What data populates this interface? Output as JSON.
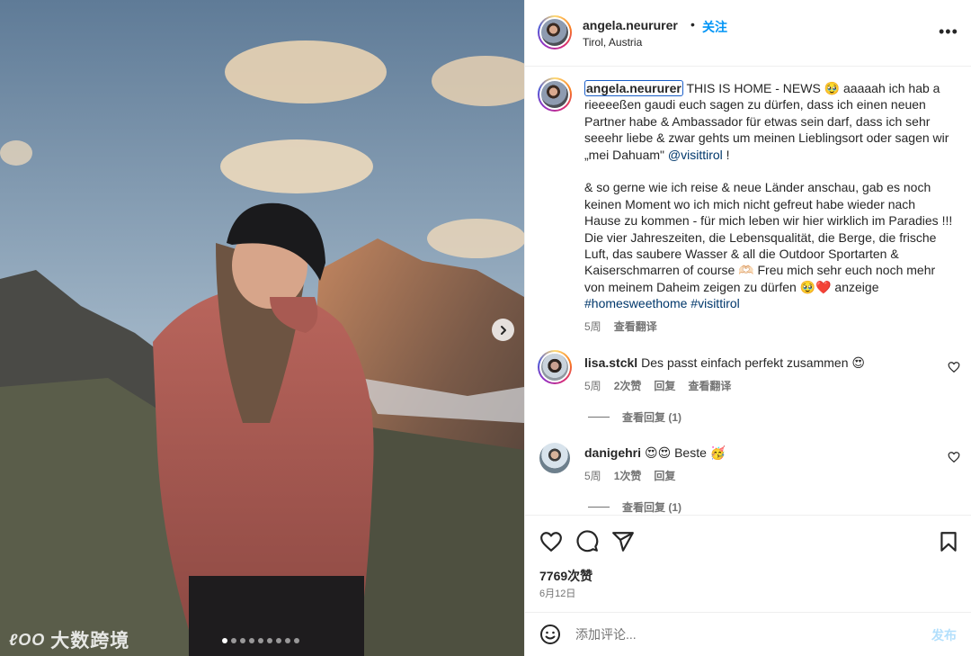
{
  "photo": {
    "carousel_total": 9,
    "carousel_active": 1,
    "watermark": "大数跨境",
    "watermark_logo": "ℓOO"
  },
  "header": {
    "username": "angela.neururer",
    "separator": "•",
    "follow_label": "关注",
    "location": "Tirol, Austria",
    "more_label": "•••"
  },
  "caption": {
    "username": "angela.neururer",
    "para1_a": " THIS IS HOME - NEWS 🥹 aaaaah ich hab a rieeeeßen gaudi euch sagen zu dürfen, dass ich einen neuen Partner habe & Ambassador für etwas sein darf, dass ich sehr seeehr liebe & zwar gehts um meinen Lieblingsort oder sagen wir „mei Dahuam\" ",
    "mention": "@visittirol",
    "para1_b": " !",
    "para2": "& so gerne wie ich reise & neue Länder anschau, gab es noch keinen Moment wo ich mich nicht gefreut habe wieder nach Hause zu kommen - für mich leben wir hier wirklich im Paradies !!! Die vier Jahreszeiten, die Lebensqualität, die Berge, die frische Luft, das saubere Wasser & all die Outdoor Sportarten & Kaiserschmarren of course 🫶🏻 Freu mich sehr euch noch mehr von meinem Daheim zeigen zu dürfen 🥹❤️ anzeige ",
    "hashtag1": "#homesweethome",
    "hashtag2": "#visittirol",
    "time": "5周",
    "translate": "查看翻译"
  },
  "comments": [
    {
      "username": "lisa.stckl",
      "text": "Des passt einfach perfekt zusammen 😍",
      "time": "5周",
      "likes": "2次赞",
      "reply": "回复",
      "translate": "查看翻译",
      "view_replies": "查看回复 (1)"
    },
    {
      "username": "danigehri",
      "text": "😍😍 Beste 🥳",
      "time": "5周",
      "likes": "1次赞",
      "reply": "回复",
      "view_replies": "查看回复 (1)"
    }
  ],
  "actions": {
    "likes": "7769次赞",
    "date": "6月12日"
  },
  "add_comment": {
    "placeholder": "添加评论...",
    "post_label": "发布"
  }
}
